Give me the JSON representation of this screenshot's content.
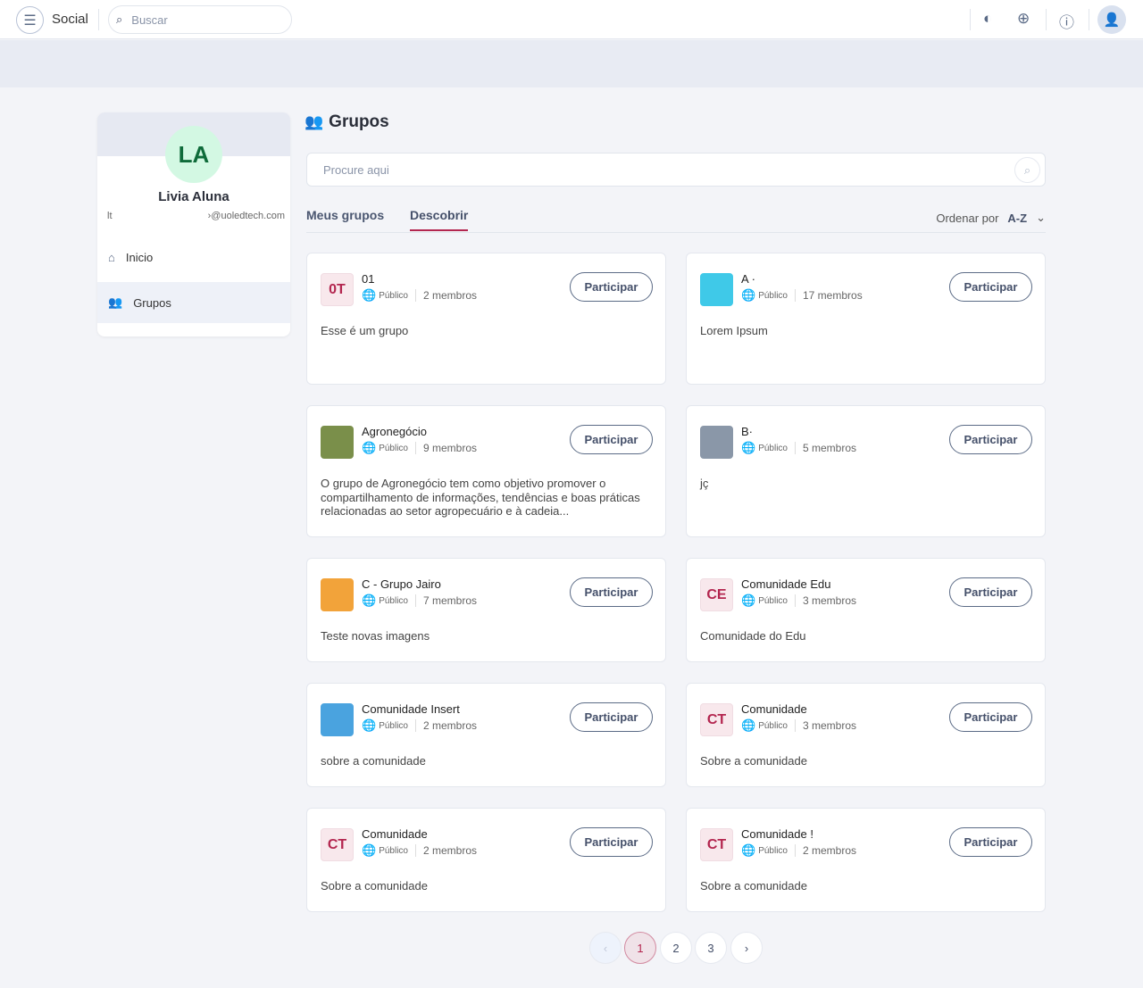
{
  "topbar": {
    "app_title": "Social",
    "search_placeholder": "Buscar"
  },
  "profile": {
    "initials": "LA",
    "name": "Livia Aluna",
    "email_prefix": "lt",
    "email_suffix": "›@uoledtech.com"
  },
  "sidebar": {
    "items": [
      {
        "label": "Inicio",
        "icon": "home-icon"
      },
      {
        "label": "Grupos",
        "icon": "users-icon",
        "active": true
      }
    ]
  },
  "main": {
    "title": "Grupos",
    "search_placeholder": "Procure aqui",
    "tabs": [
      {
        "label": "Meus grupos"
      },
      {
        "label": "Descobrir",
        "active": true
      }
    ],
    "sort_label": "Ordenar por",
    "sort_value": "A-Z",
    "join_label": "Participar",
    "groups": [
      {
        "title": "01",
        "initials": "0T",
        "visibility": "Público",
        "members": "2 membros",
        "desc": "Esse é um grupo"
      },
      {
        "title": "A ·",
        "initials": "",
        "visibility": "Público",
        "members": "17 membros",
        "desc": "Lorem Ipsum",
        "thumb_color": "#3fc9e8"
      },
      {
        "title": "Agronegócio",
        "initials": "",
        "visibility": "Público",
        "members": "9 membros",
        "desc": "O grupo de Agronegócio tem como objetivo promover o compartilhamento de informações, tendências e boas práticas relacionadas ao setor agropecuário e à cadeia...",
        "thumb_color": "#7a8f4a"
      },
      {
        "title": "B·",
        "initials": "",
        "visibility": "Público",
        "members": "5 membros",
        "desc": "jç",
        "thumb_color": "#8a97a8"
      },
      {
        "title": "C - Grupo Jairo",
        "initials": "",
        "visibility": "Público",
        "members": "7 membros",
        "desc": "Teste novas imagens",
        "thumb_color": "#f2a33a"
      },
      {
        "title": "Comunidade Edu",
        "initials": "CE",
        "visibility": "Público",
        "members": "3 membros",
        "desc": "Comunidade do Edu"
      },
      {
        "title": "Comunidade Insert",
        "initials": "",
        "visibility": "Público",
        "members": "2 membros",
        "desc": "sobre a comunidade",
        "thumb_color": "#4aa3df"
      },
      {
        "title": "Comunidade",
        "initials": "CT",
        "visibility": "Público",
        "members": "3 membros",
        "desc": "Sobre a comunidade"
      },
      {
        "title": "Comunidade",
        "initials": "CT",
        "visibility": "Público",
        "members": "2 membros",
        "desc": "Sobre a comunidade"
      },
      {
        "title": "Comunidade !",
        "initials": "CT",
        "visibility": "Público",
        "members": "2 membros",
        "desc": "Sobre a comunidade"
      }
    ]
  },
  "pagination": {
    "pages": [
      "1",
      "2",
      "3"
    ],
    "current": "1",
    "prev": "‹",
    "next": "›"
  },
  "colors": {
    "accent": "#b3264f",
    "avatar_bg": "#d3f8e3"
  }
}
